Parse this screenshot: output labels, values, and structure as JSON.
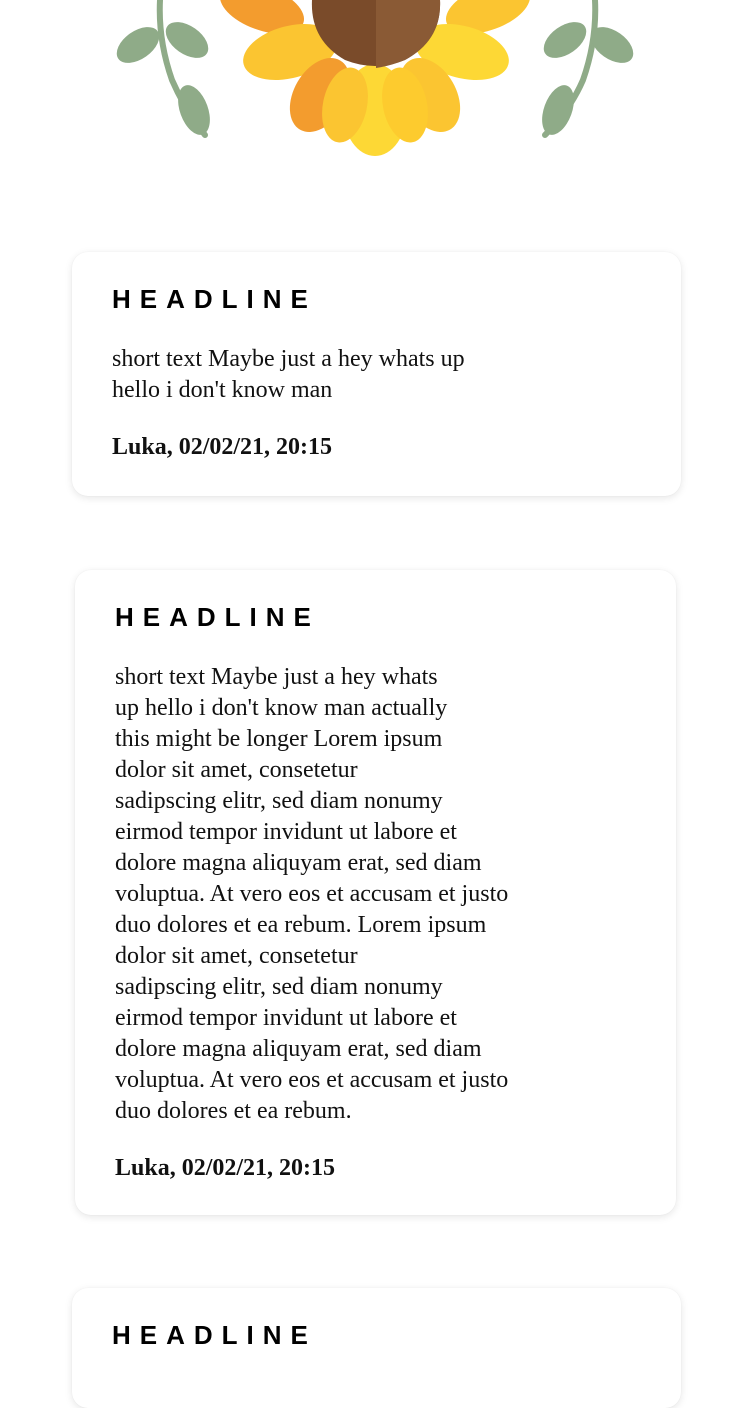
{
  "header": {
    "illustration": "sunflower-with-leaves",
    "colors": {
      "petal_yellow": "#fbc531",
      "petal_orange": "#f39c2e",
      "center_brown": "#7a4b2a",
      "leaf_green": "#8fab88"
    }
  },
  "posts": [
    {
      "headline": "HEADLINE",
      "body": "short text Maybe just a hey whats up\nhello i don't know man",
      "meta": "Luka, 02/02/21, 20:15"
    },
    {
      "headline": "HEADLINE",
      "body": "short text Maybe just a hey whats\nup hello i don't know man actually\nthis might be longer Lorem ipsum\ndolor sit amet, consetetur\nsadipscing elitr, sed diam nonumy\neirmod tempor invidunt ut labore et\ndolore magna aliquyam erat, sed diam\nvoluptua. At vero eos et accusam et justo\nduo dolores et ea rebum. Lorem ipsum\ndolor sit amet, consetetur\nsadipscing elitr, sed diam nonumy\neirmod tempor invidunt ut labore et\ndolore magna aliquyam erat, sed diam\nvoluptua. At vero eos et accusam et justo\nduo dolores et ea rebum.",
      "meta": "Luka, 02/02/21, 20:15"
    },
    {
      "headline": "HEADLINE"
    }
  ]
}
